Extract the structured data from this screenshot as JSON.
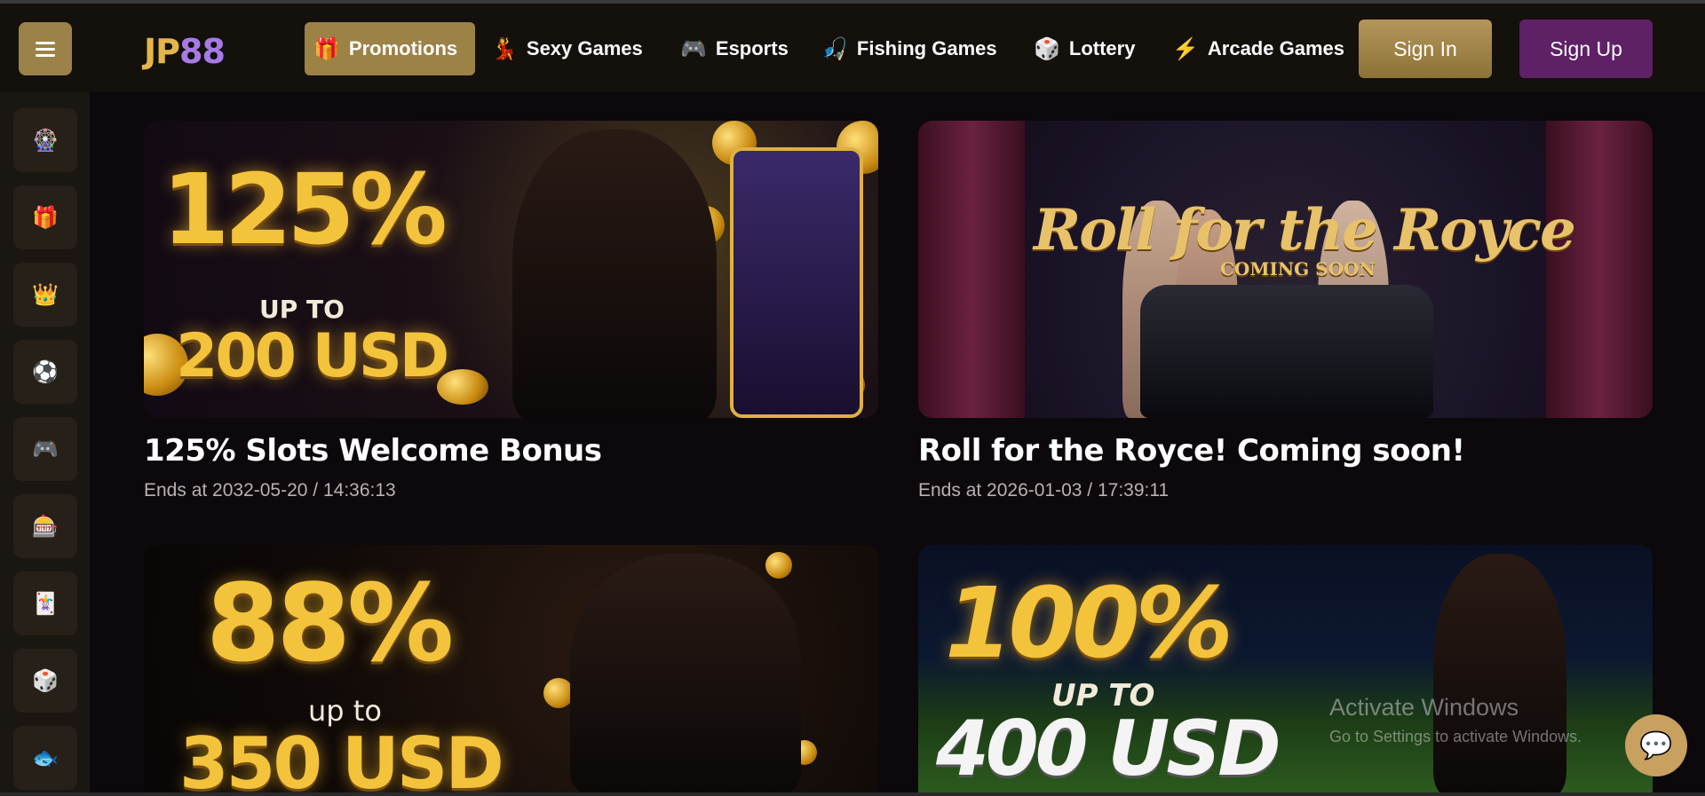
{
  "header": {
    "logo": {
      "part1": "JP",
      "part2": "88"
    },
    "nav": [
      {
        "icon": "🎁",
        "label": "Promotions",
        "active": true
      },
      {
        "icon": "💃",
        "label": "Sexy Games"
      },
      {
        "icon": "🎮",
        "label": "Esports"
      },
      {
        "icon": "🎣",
        "label": "Fishing Games"
      },
      {
        "icon": "🎲",
        "label": "Lottery"
      },
      {
        "icon": "⚡",
        "label": "Arcade Games"
      }
    ],
    "sign_in": "Sign In",
    "sign_up": "Sign Up"
  },
  "sidebar": {
    "items": [
      {
        "icon": "🎡",
        "name": "wheel-icon"
      },
      {
        "icon": "🎁",
        "name": "gift-icon"
      },
      {
        "icon": "👑",
        "name": "crown-icon"
      },
      {
        "icon": "⚽",
        "name": "soccer-ball-icon"
      },
      {
        "icon": "🎮",
        "name": "gamepad-icon"
      },
      {
        "icon": "🎰",
        "name": "casino-chip-icon"
      },
      {
        "icon": "🃏",
        "name": "card-table-icon"
      },
      {
        "icon": "🎲",
        "name": "lottery-balls-icon"
      },
      {
        "icon": "🐟",
        "name": "fish-icon"
      }
    ]
  },
  "promotions": [
    {
      "title": "125% Slots Welcome Bonus",
      "ends": "Ends at 2032-05-20 / 14:36:13",
      "banner": {
        "big": "125%",
        "mid": "UP TO",
        "low": "200 USD"
      }
    },
    {
      "title": "Roll for the Royce! Coming soon!",
      "ends": "Ends at 2026-01-03 / 17:39:11",
      "banner": {
        "big": "Roll for the Royce",
        "mid": "COMING SOON"
      }
    },
    {
      "title": "",
      "ends": "",
      "banner": {
        "big": "88%",
        "mid": "up to",
        "low": "350 USD"
      }
    },
    {
      "title": "",
      "ends": "",
      "banner": {
        "big": "100%",
        "mid": "UP TO",
        "low": "400 USD"
      }
    }
  ],
  "watermark": {
    "line1": "Activate Windows",
    "line2": "Go to Settings to activate Windows."
  },
  "chat": {
    "icon": "💬"
  }
}
